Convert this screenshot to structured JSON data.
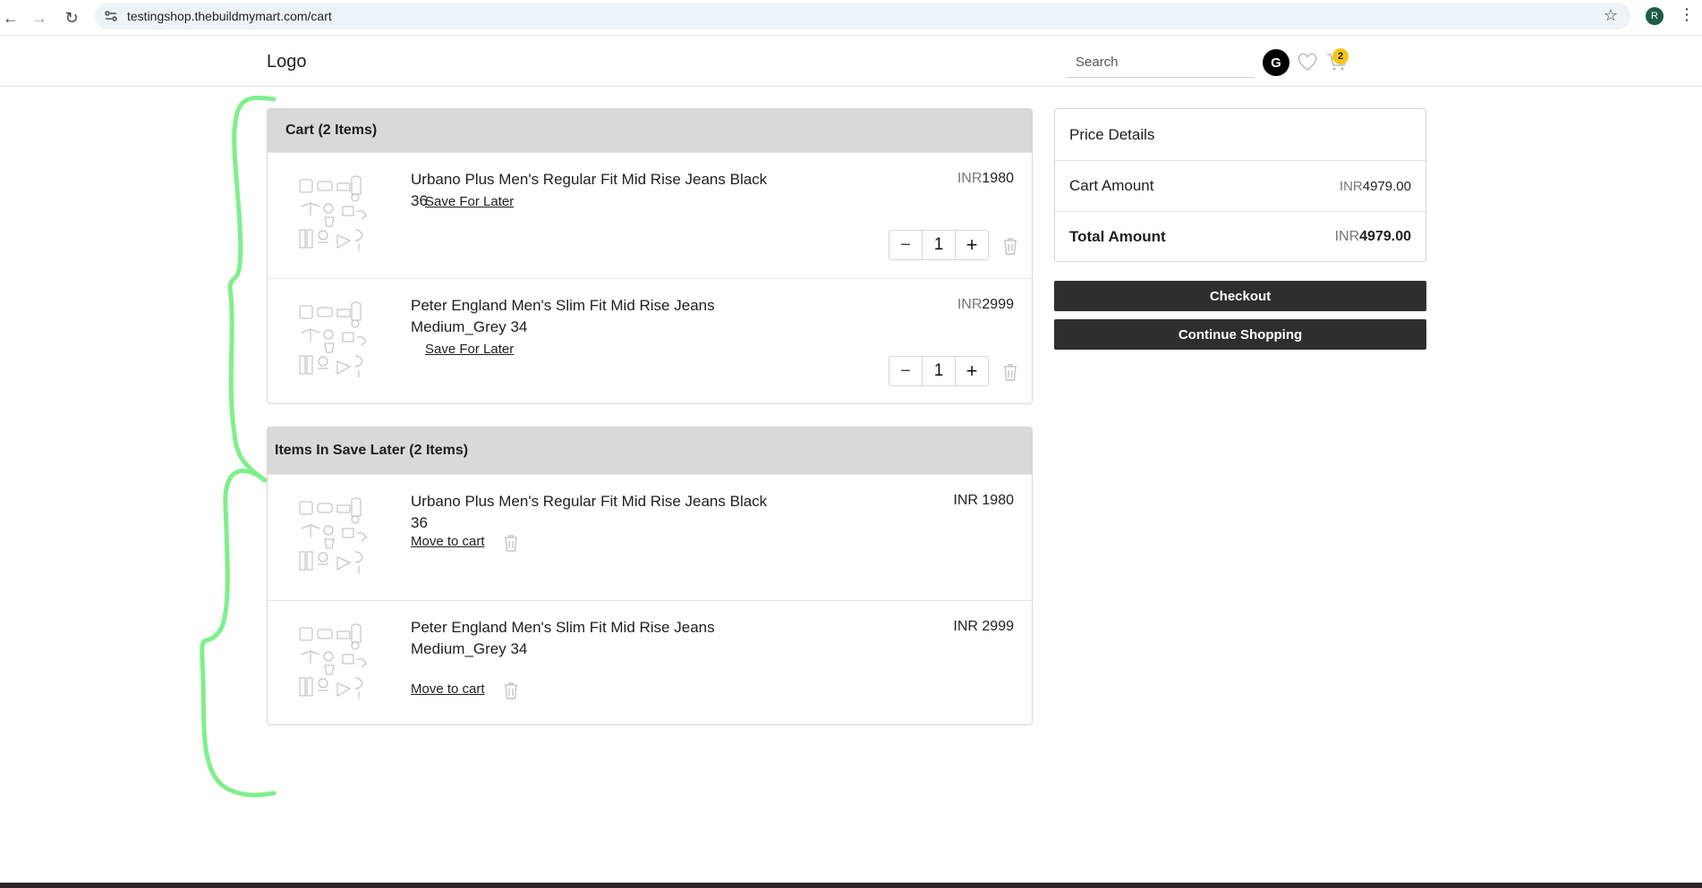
{
  "browser": {
    "url": "testingshop.thebuildmymart.com/cart",
    "profile_initial": "R"
  },
  "header": {
    "logo": "Logo",
    "search_placeholder": "Search",
    "user_initial": "G",
    "cart_count": "2"
  },
  "cart": {
    "title": "Cart (2 Items)",
    "items": [
      {
        "name": "Urbano Plus Men's Regular Fit Mid Rise Jeans Black 36",
        "currency": "INR",
        "price": "1980",
        "save_label": "Save For Later",
        "qty": "1"
      },
      {
        "name": "Peter England Men's Slim Fit Mid Rise Jeans Medium_Grey 34",
        "currency": "INR",
        "price": "2999",
        "save_label": "Save For Later",
        "qty": "1"
      }
    ],
    "minus": "−",
    "plus": "+"
  },
  "saved": {
    "title": "Items In Save Later (2 Items)",
    "items": [
      {
        "name": "Urbano Plus Men's Regular Fit Mid Rise Jeans Black 36",
        "price": "INR 1980",
        "move_label": "Move to cart"
      },
      {
        "name": "Peter England Men's Slim Fit Mid Rise Jeans Medium_Grey 34",
        "price": "INR 2999",
        "move_label": "Move to cart"
      }
    ]
  },
  "price_details": {
    "title": "Price Details",
    "cart_amount_label": "Cart Amount",
    "cart_amount_currency": "INR",
    "cart_amount_value": "4979.00",
    "total_label": "Total Amount",
    "total_currency": "INR",
    "total_value": "4979.00"
  },
  "actions": {
    "checkout": "Checkout",
    "continue": "Continue Shopping"
  },
  "colors": {
    "annotation_brace": "#7ef08a",
    "badge": "#f5c518",
    "button_dark": "#2e2e2e",
    "panel_header": "#d9d9d9"
  }
}
